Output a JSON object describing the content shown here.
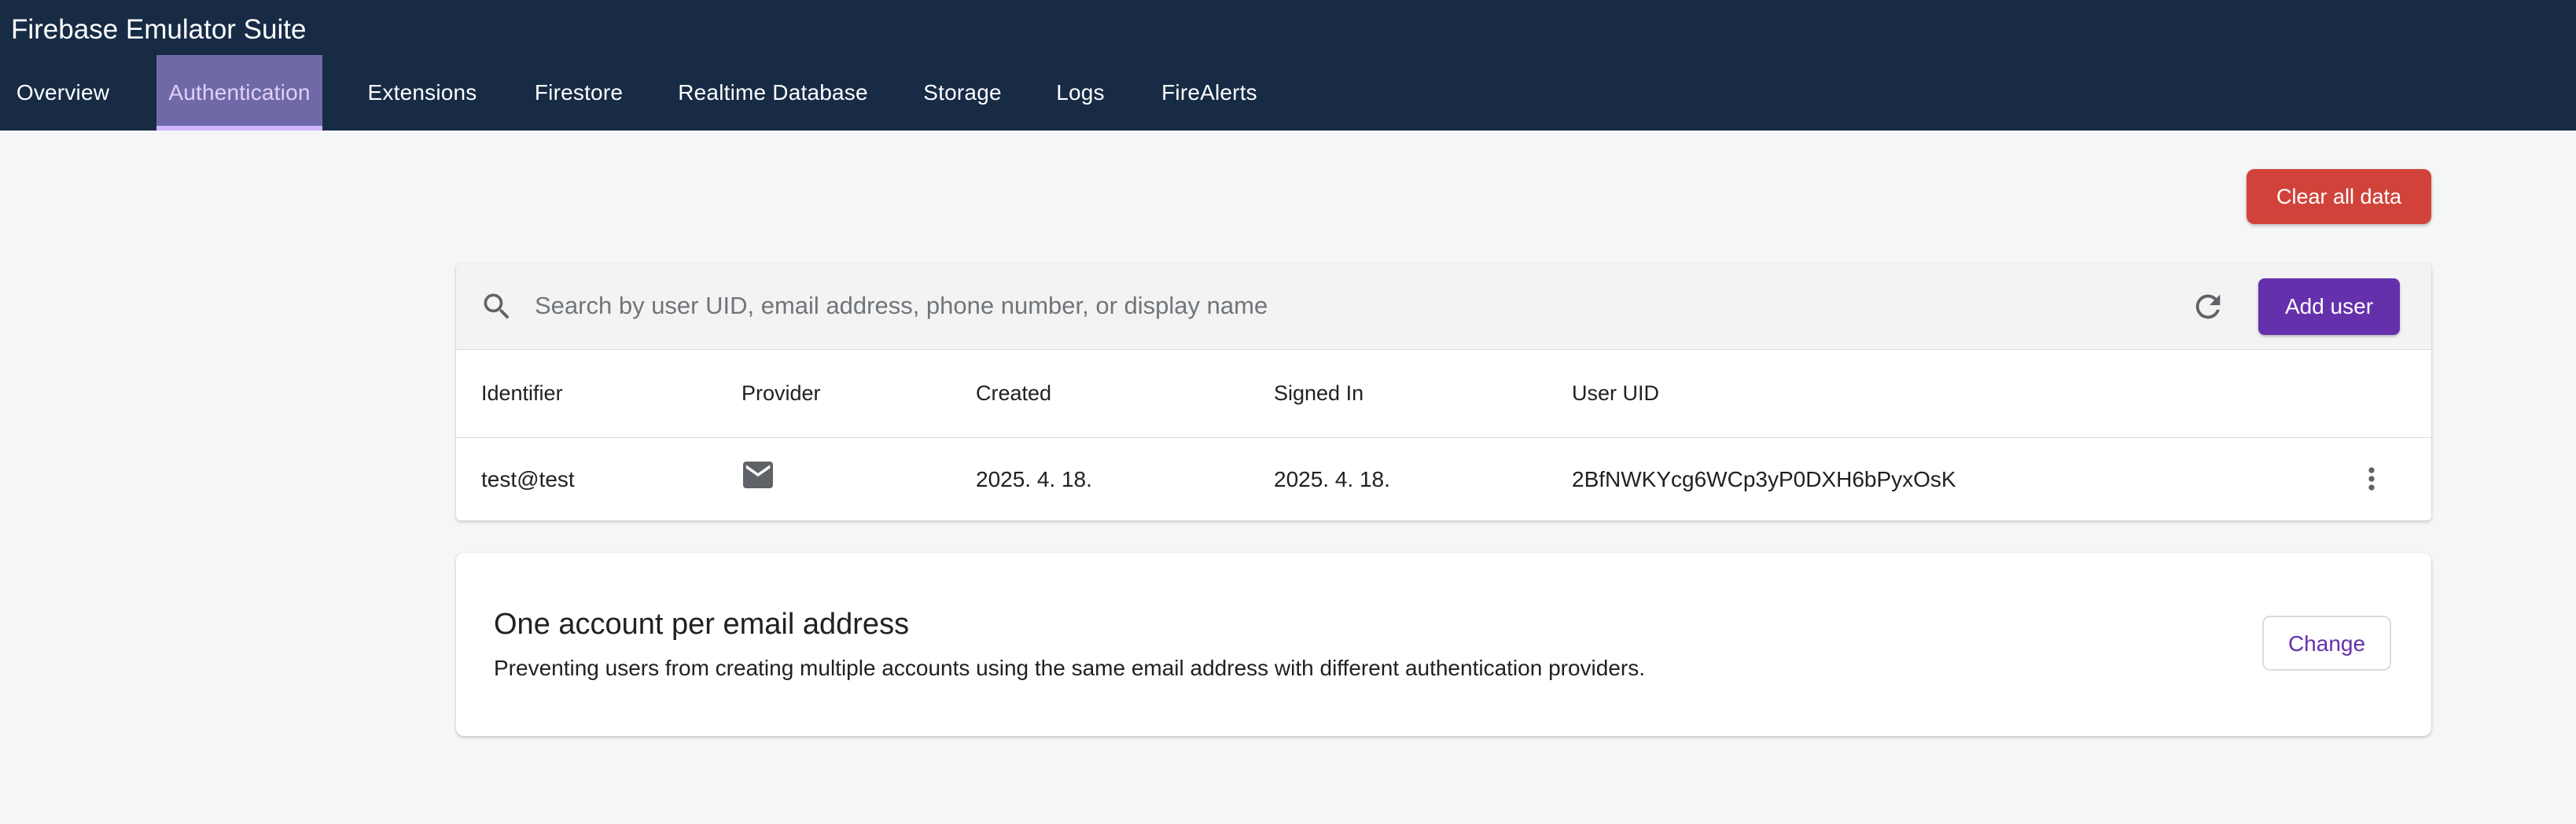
{
  "app": {
    "title": "Firebase Emulator Suite"
  },
  "nav": {
    "tabs": [
      {
        "label": "Overview",
        "active": false
      },
      {
        "label": "Authentication",
        "active": true
      },
      {
        "label": "Extensions",
        "active": false
      },
      {
        "label": "Firestore",
        "active": false
      },
      {
        "label": "Realtime Database",
        "active": false
      },
      {
        "label": "Storage",
        "active": false
      },
      {
        "label": "Logs",
        "active": false
      },
      {
        "label": "FireAlerts",
        "active": false
      }
    ]
  },
  "toolbar": {
    "clear_label": "Clear all data"
  },
  "search": {
    "placeholder": "Search by user UID, email address, phone number, or display name",
    "value": "",
    "search_icon": "search-icon",
    "refresh_icon": "refresh-icon",
    "add_user_label": "Add user"
  },
  "table": {
    "headers": {
      "identifier": "Identifier",
      "provider": "Provider",
      "created": "Created",
      "signed_in": "Signed In",
      "uid": "User UID"
    },
    "rows": [
      {
        "identifier": "test@test",
        "provider_icon": "email-icon",
        "created": "2025. 4. 18.",
        "signed_in": "2025. 4. 18.",
        "uid": "2BfNWKYcg6WCp3yP0DXH6bPyxOsK",
        "menu_icon": "more-vert-icon"
      }
    ]
  },
  "email_setting": {
    "title": "One account per email address",
    "description": "Preventing users from creating multiple accounts using the same email address with different authentication providers.",
    "change_label": "Change"
  },
  "colors": {
    "header_bg": "#172b45",
    "active_tab_bg": "#6f6aa7",
    "active_tab_text": "#e1cff9",
    "danger": "#d1433a",
    "primary": "#6530ac",
    "page_bg": "#f5f6f8"
  }
}
